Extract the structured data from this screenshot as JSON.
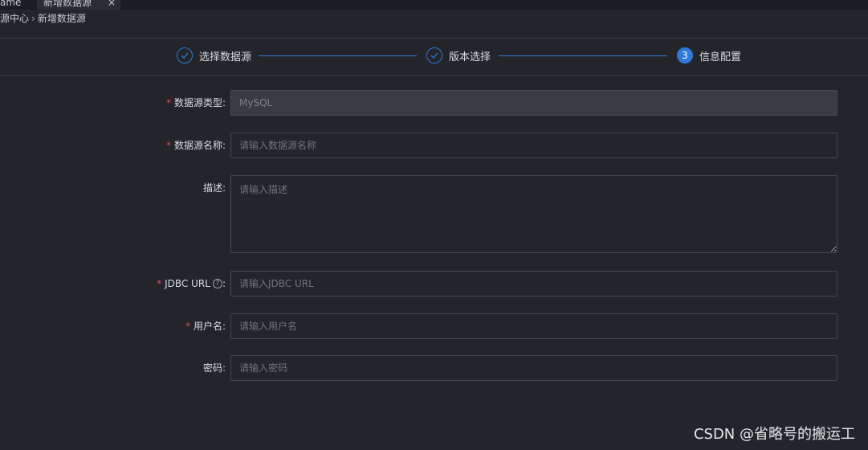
{
  "tabs": [
    {
      "label": "ame"
    },
    {
      "label": "新增数据源",
      "close": "×"
    }
  ],
  "breadcrumb": {
    "parent": "源中心",
    "separator": "›",
    "current": "新增数据源"
  },
  "steps": [
    {
      "label": "选择数据源",
      "status": "done",
      "icon": "check-icon"
    },
    {
      "label": "版本选择",
      "status": "done",
      "icon": "check-icon"
    },
    {
      "label": "信息配置",
      "status": "active",
      "number": "3"
    }
  ],
  "form": {
    "type": {
      "label": "数据源类型:",
      "required": true,
      "value": "MySQL"
    },
    "name": {
      "label": "数据源名称:",
      "required": true,
      "placeholder": "请输入数据源名称"
    },
    "description": {
      "label": "描述:",
      "required": false,
      "placeholder": "请输入描述"
    },
    "jdbc_url": {
      "label": "JDBC URL",
      "colon": ":",
      "required": true,
      "placeholder": "请输入JDBC URL"
    },
    "username": {
      "label": "用户名:",
      "required": true,
      "placeholder": "请输入用户名"
    },
    "password": {
      "label": "密码:",
      "required": false,
      "placeholder": "请输入密码"
    }
  },
  "watermark": "CSDN @省略号的搬运工",
  "colors": {
    "accent": "#2f7ad8",
    "required": "#e24b4b",
    "background": "#23252b"
  }
}
